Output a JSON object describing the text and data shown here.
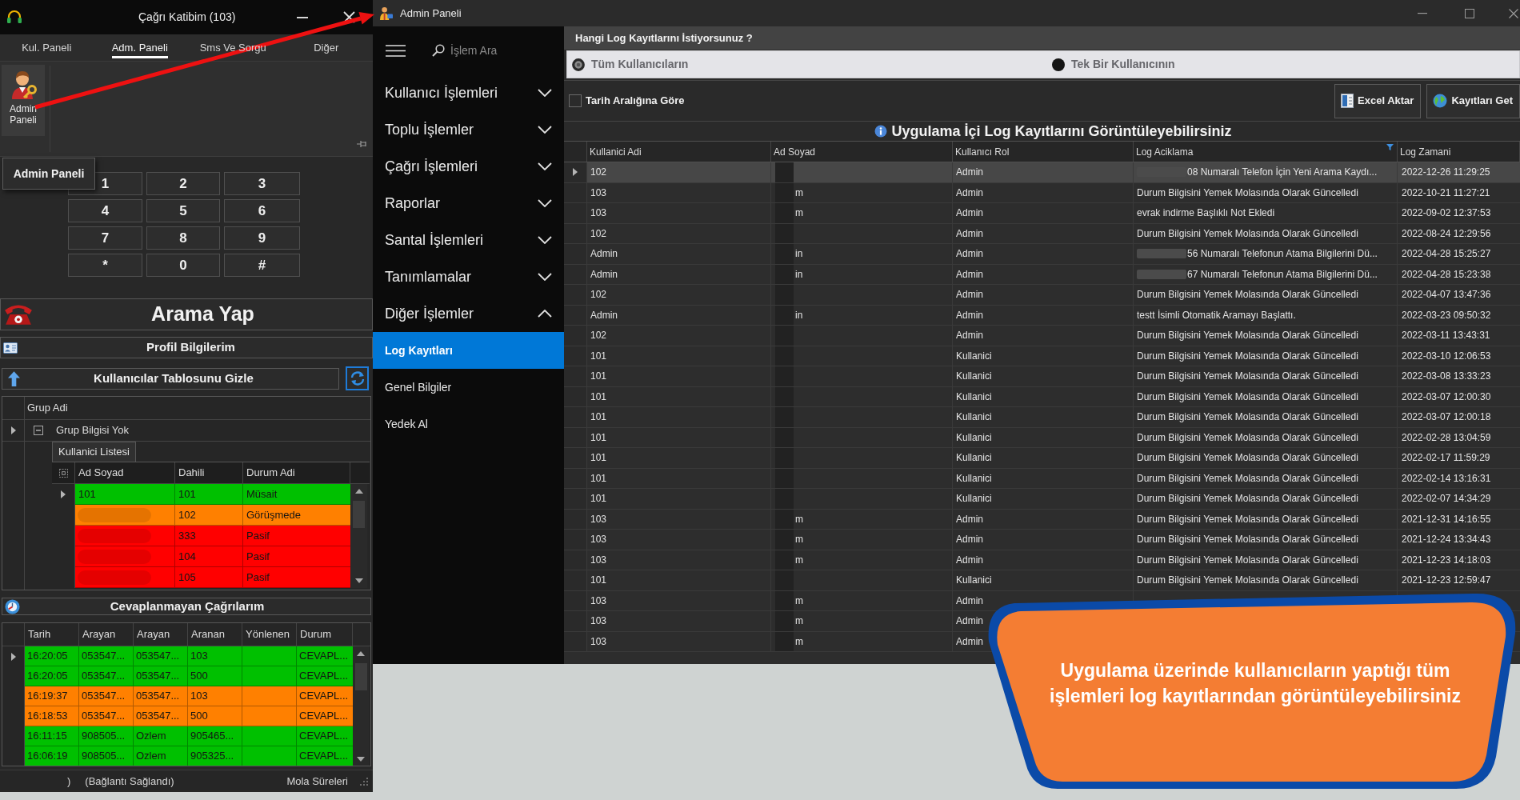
{
  "left_window": {
    "title": "Çağrı Katibim (103)",
    "tabs": [
      {
        "label": "Kul. Paneli",
        "selected": false
      },
      {
        "label": "Adm. Paneli",
        "selected": true
      },
      {
        "label": "Sms Ve Sorgu",
        "selected": false
      },
      {
        "label": "Diğer",
        "selected": false
      }
    ],
    "ribbon_button": "Admin Paneli",
    "tooltip": "Admin Paneli",
    "keypad": [
      "1",
      "2",
      "3",
      "4",
      "5",
      "6",
      "7",
      "8",
      "9",
      "*",
      "0",
      "#"
    ],
    "call_button": "Arama Yap",
    "profile_button": "Profil Bilgilerim",
    "users_toggle_button": "Kullanıcılar Tablosunu Gizle",
    "groups_grid": {
      "column": "Grup Adi",
      "group": {
        "label": "Grup Bilgisi Yok",
        "expanded": true,
        "selected": true,
        "tab": "Kullanici Listesi",
        "columns": [
          "Ad Soyad",
          "Dahili",
          "Durum Adi"
        ],
        "rows": [
          {
            "ad_soyad": "101",
            "redacted": false,
            "dahili": "101",
            "durum": "Müsait",
            "color": "#00c000",
            "selected": true
          },
          {
            "redacted": true,
            "dahili": "102",
            "durum": "Görüşmede",
            "color": "#ff8000",
            "selected": false
          },
          {
            "redacted": true,
            "dahili": "333",
            "durum": "Pasif",
            "color": "#ff0000",
            "selected": false
          },
          {
            "redacted": true,
            "dahili": "104",
            "durum": "Pasif",
            "color": "#ff0000",
            "selected": false
          },
          {
            "redacted": true,
            "dahili": "105",
            "durum": "Pasif",
            "color": "#ff0000",
            "selected": false
          }
        ]
      }
    },
    "missed_calls": {
      "title": "Cevaplanmayan Çağrılarım",
      "columns": [
        "Tarih",
        "Arayan",
        "Arayan",
        "Aranan",
        "Yönlenen",
        "Durum"
      ],
      "rows": [
        {
          "tarih": "16:20:05",
          "arayan_1": "053547...",
          "arayan_2": "053547...",
          "aranan": "103",
          "durum": "CEVAPL...",
          "color": "#00c000",
          "selected": true
        },
        {
          "tarih": "16:20:05",
          "arayan_1": "053547...",
          "arayan_2": "053547...",
          "aranan": "500",
          "durum": "CEVAPL...",
          "color": "#00c000",
          "selected": false
        },
        {
          "tarih": "16:19:37",
          "arayan_1": "053547...",
          "arayan_2": "053547...",
          "aranan": "103",
          "durum": "CEVAPL...",
          "color": "#ff8000",
          "selected": false
        },
        {
          "tarih": "16:18:53",
          "arayan_1": "053547...",
          "arayan_2": "053547...",
          "aranan": "500",
          "durum": "CEVAPL...",
          "color": "#ff8000",
          "selected": false
        },
        {
          "tarih": "16:11:15",
          "arayan_1": "908505...",
          "arayan_2": "Ozlem",
          "aranan": "905465...",
          "durum": "CEVAPL...",
          "color": "#00c000",
          "selected": false
        },
        {
          "tarih": "16:06:19",
          "arayan_1": "908505...",
          "arayan_2": "Ozlem",
          "aranan": "905325...",
          "durum": "CEVAPL...",
          "color": "#00c000",
          "selected": false
        }
      ]
    },
    "status_bar": {
      "fragment": ")",
      "connection": "(Bağlantı Sağlandı)",
      "breaks": "Mola Süreleri"
    }
  },
  "admin_window": {
    "title": "Admin Paneli",
    "sidebar": {
      "search_placeholder": "İşlem Ara",
      "items": [
        {
          "label": "Kullanıcı İşlemleri",
          "expanded": false
        },
        {
          "label": "Toplu İşlemler",
          "expanded": false
        },
        {
          "label": "Çağrı İşlemleri",
          "expanded": false
        },
        {
          "label": "Raporlar",
          "expanded": false
        },
        {
          "label": "Santal İşlemleri",
          "expanded": false
        },
        {
          "label": "Tanımlamalar",
          "expanded": false
        },
        {
          "label": "Diğer İşlemler",
          "expanded": true,
          "children": [
            {
              "label": "Log Kayıtları",
              "selected": true
            },
            {
              "label": "Genel Bilgiler",
              "selected": false
            },
            {
              "label": "Yedek Al",
              "selected": false
            }
          ]
        }
      ]
    },
    "filter": {
      "heading": "Hangi Log Kayıtlarını İstiyorsunuz ?",
      "options": [
        {
          "label": "Tüm Kullanıcıların",
          "selected": true
        },
        {
          "label": "Tek Bir Kullanıcının",
          "selected": false
        }
      ],
      "date_range": {
        "label": "Tarih Aralığına Göre",
        "checked": false
      },
      "buttons": [
        {
          "label": "Excel Aktar",
          "kind": "excel"
        },
        {
          "label": "Kayıtları Get",
          "kind": "fetch"
        }
      ]
    },
    "log_title": "Uygulama İçi Log Kayıtlarını Görüntüleyebilirsiniz",
    "log_table": {
      "columns": [
        {
          "label": "Kullanici Adi",
          "filtered": false
        },
        {
          "label": "Ad Soyad",
          "filtered": false
        },
        {
          "label": "Kullanıcı Rol",
          "filtered": false
        },
        {
          "label": "Log Aciklama",
          "filtered": true
        },
        {
          "label": "Log Zamani",
          "filtered": false
        }
      ],
      "rows": [
        {
          "kullanici_adi": "102",
          "rol": "Admin",
          "aciklama": "08 Numaralı Telefon İçin Yeni Arama Kaydı...",
          "zaman": "2022-12-26 11:29:25",
          "masked": true,
          "selected": true
        },
        {
          "kullanici_adi": "103",
          "ad_soyad": "m",
          "rol": "Admin",
          "aciklama": "Durum Bilgisini Yemek Molasında Olarak Güncelledi",
          "zaman": "2022-10-21 11:27:21",
          "masked": false,
          "selected": false
        },
        {
          "kullanici_adi": "103",
          "ad_soyad": "m",
          "rol": "Admin",
          "aciklama": "evrak indirme Başlıklı Not Ekledi",
          "zaman": "2022-09-02 12:37:53",
          "masked": false,
          "selected": false
        },
        {
          "kullanici_adi": "102",
          "rol": "Admin",
          "aciklama": "Durum Bilgisini Yemek Molasında Olarak Güncelledi",
          "zaman": "2022-08-24 12:29:56",
          "masked": false,
          "selected": false
        },
        {
          "kullanici_adi": "Admin",
          "ad_soyad": "in",
          "rol": "Admin",
          "aciklama": "56 Numaralı Telefonun Atama Bilgilerini Dü...",
          "zaman": "2022-04-28 15:25:27",
          "masked": true,
          "selected": false
        },
        {
          "kullanici_adi": "Admin",
          "ad_soyad": "in",
          "rol": "Admin",
          "aciklama": "67 Numaralı Telefonun Atama Bilgilerini Dü...",
          "zaman": "2022-04-28 15:23:38",
          "masked": true,
          "selected": false
        },
        {
          "kullanici_adi": "102",
          "rol": "Admin",
          "aciklama": "Durum Bilgisini Yemek Molasında Olarak Güncelledi",
          "zaman": "2022-04-07 13:47:36",
          "masked": false,
          "selected": false
        },
        {
          "kullanici_adi": "Admin",
          "ad_soyad": "in",
          "rol": "Admin",
          "aciklama": "testt İsimli Otomatik Aramayı Başlattı.",
          "zaman": "2022-03-23 09:50:32",
          "masked": false,
          "selected": false
        },
        {
          "kullanici_adi": "102",
          "rol": "Admin",
          "aciklama": "Durum Bilgisini Yemek Molasında Olarak Güncelledi",
          "zaman": "2022-03-11 13:43:31",
          "masked": false,
          "selected": false
        },
        {
          "kullanici_adi": "101",
          "rol": "Kullanici",
          "aciklama": "Durum Bilgisini Yemek Molasında Olarak Güncelledi",
          "zaman": "2022-03-10 12:06:53",
          "masked": false,
          "selected": false
        },
        {
          "kullanici_adi": "101",
          "rol": "Kullanici",
          "aciklama": "Durum Bilgisini Yemek Molasında Olarak Güncelledi",
          "zaman": "2022-03-08 13:33:23",
          "masked": false,
          "selected": false
        },
        {
          "kullanici_adi": "101",
          "rol": "Kullanici",
          "aciklama": "Durum Bilgisini Yemek Molasında Olarak Güncelledi",
          "zaman": "2022-03-07 12:00:30",
          "masked": false,
          "selected": false
        },
        {
          "kullanici_adi": "101",
          "rol": "Kullanici",
          "aciklama": "Durum Bilgisini Yemek Molasında Olarak Güncelledi",
          "zaman": "2022-03-07 12:00:18",
          "masked": false,
          "selected": false
        },
        {
          "kullanici_adi": "101",
          "rol": "Kullanici",
          "aciklama": "Durum Bilgisini Yemek Molasında Olarak Güncelledi",
          "zaman": "2022-02-28 13:04:59",
          "masked": false,
          "selected": false
        },
        {
          "kullanici_adi": "101",
          "rol": "Kullanici",
          "aciklama": "Durum Bilgisini Yemek Molasında Olarak Güncelledi",
          "zaman": "2022-02-17 11:59:29",
          "masked": false,
          "selected": false
        },
        {
          "kullanici_adi": "101",
          "rol": "Kullanici",
          "aciklama": "Durum Bilgisini Yemek Molasında Olarak Güncelledi",
          "zaman": "2022-02-14 13:16:31",
          "masked": false,
          "selected": false
        },
        {
          "kullanici_adi": "101",
          "rol": "Kullanici",
          "aciklama": "Durum Bilgisini Yemek Molasında Olarak Güncelledi",
          "zaman": "2022-02-07 14:34:29",
          "masked": false,
          "selected": false
        },
        {
          "kullanici_adi": "103",
          "ad_soyad": "m",
          "rol": "Admin",
          "aciklama": "Durum Bilgisini Yemek Molasında Olarak Güncelledi",
          "zaman": "2021-12-31 14:16:55",
          "masked": false,
          "selected": false
        },
        {
          "kullanici_adi": "103",
          "ad_soyad": "m",
          "rol": "Admin",
          "aciklama": "Durum Bilgisini Yemek Molasında Olarak Güncelledi",
          "zaman": "2021-12-24 13:34:43",
          "masked": false,
          "selected": false
        },
        {
          "kullanici_adi": "103",
          "ad_soyad": "m",
          "rol": "Admin",
          "aciklama": "Durum Bilgisini Yemek Molasında Olarak Güncelledi",
          "zaman": "2021-12-23 14:18:03",
          "masked": false,
          "selected": false
        },
        {
          "kullanici_adi": "101",
          "rol": "Kullanici",
          "aciklama": "Durum Bilgisini Yemek Molasında Olarak Güncelledi",
          "zaman": "2021-12-23 12:59:47",
          "masked": false,
          "selected": false
        },
        {
          "kullanici_adi": "103",
          "ad_soyad": "m",
          "rol": "Admin",
          "masked": false,
          "selected": false
        },
        {
          "kullanici_adi": "103",
          "ad_soyad": "m",
          "rol": "Admin",
          "masked": false,
          "selected": false
        },
        {
          "kullanici_adi": "103",
          "ad_soyad": "m",
          "rol": "Admin",
          "masked": false,
          "selected": false
        }
      ]
    }
  },
  "callout": {
    "text": "Uygulama üzerinde kullanıcıların yaptığı tüm işlemleri log kayıtlarından görüntüleyebilirsiniz"
  }
}
